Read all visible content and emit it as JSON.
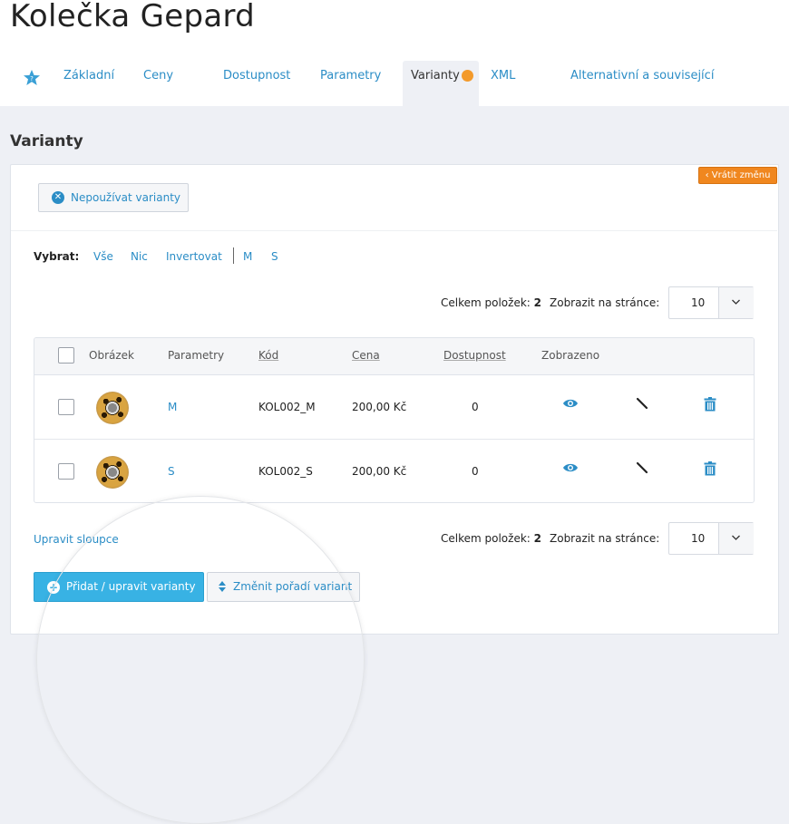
{
  "page": {
    "title": "Kolečka Gepard"
  },
  "tabs": [
    {
      "label": "Základní"
    },
    {
      "label": "Ceny"
    },
    {
      "label": "Dostupnost"
    },
    {
      "label": "Parametry"
    },
    {
      "label": "Varianty",
      "active": true
    },
    {
      "label": "XML"
    },
    {
      "label": "Alternativní a související"
    }
  ],
  "section": {
    "title": "Varianty",
    "revert_label": "‹ Vrátit změnu"
  },
  "no_variants_button": "Nepoužívat varianty",
  "select": {
    "label": "Vybrat:",
    "options": [
      "Vše",
      "Nic",
      "Invertovat",
      "M",
      "S"
    ]
  },
  "summary": {
    "total_label": "Celkem položek:",
    "total": "2",
    "per_page_label": "Zobrazit na stránce:",
    "per_page": "10"
  },
  "table": {
    "headers": [
      "Obrázek",
      "Parametry",
      "Kód",
      "Cena",
      "Dostupnost",
      "Zobrazeno"
    ],
    "rows": [
      {
        "param": "M",
        "code": "KOL002_M",
        "price": "200,00 Kč",
        "availability": "0"
      },
      {
        "param": "S",
        "code": "KOL002_S",
        "price": "200,00 Kč",
        "availability": "0"
      }
    ]
  },
  "edit_columns": "Upravit sloupce",
  "buttons": {
    "add_edit": "Přidat / upravit varianty",
    "reorder": "Změnit pořadí variant"
  },
  "colors": {
    "accent": "#2b8dc6",
    "primary": "#38b2e4",
    "warning": "#f0871f",
    "status_dot": "#f39a2b"
  }
}
